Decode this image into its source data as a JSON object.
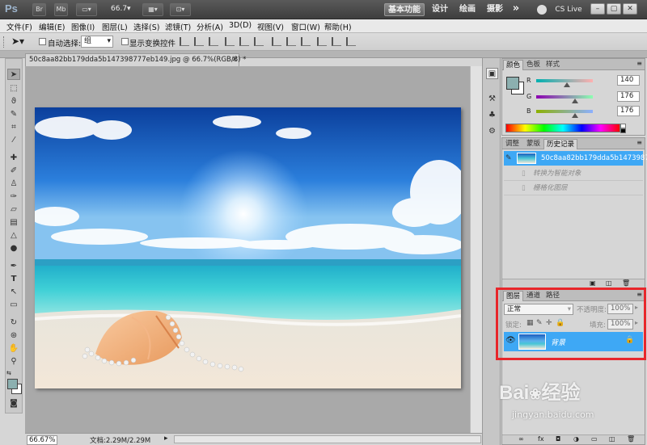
{
  "titlebar": {
    "app_logo": "Ps",
    "bridge_btn": "Br",
    "minibridge_btn": "Mb",
    "zoom_value": "66.7",
    "workspaces": [
      "基本功能",
      "设计",
      "绘画",
      "摄影"
    ],
    "more_symbol": "»",
    "cslive": "CS Live"
  },
  "menu": [
    "文件(F)",
    "编辑(E)",
    "图像(I)",
    "图层(L)",
    "选择(S)",
    "滤镜(T)",
    "分析(A)",
    "3D(D)",
    "视图(V)",
    "窗口(W)",
    "帮助(H)"
  ],
  "options": {
    "auto_select_label": "自动选择:",
    "auto_select_value": "组",
    "show_transform_label": "显示变换控件"
  },
  "document": {
    "tab_title": "50c8aa82bb179dda5b147398777eb149.jpg @ 66.7%(RGB/8) *",
    "close_symbol": "×"
  },
  "status": {
    "zoom": "66.67%",
    "doc_info": "文档:2.29M/2.29M"
  },
  "color_panel": {
    "tabs": [
      "颜色",
      "色板",
      "样式"
    ],
    "channels": [
      {
        "label": "R",
        "value": "140"
      },
      {
        "label": "G",
        "value": "176"
      },
      {
        "label": "B",
        "value": "176"
      }
    ],
    "r_fraction": 0.549,
    "g_fraction": 0.69,
    "b_fraction": 0.69,
    "swatch_color": "#8cb0b0"
  },
  "history_panel": {
    "tabs": [
      "调整",
      "蒙版",
      "历史记录"
    ],
    "snapshot_name": "50c8aa82bb179dda5b1473987...",
    "steps": [
      "转换为智能对象",
      "栅格化图层"
    ]
  },
  "layers_panel": {
    "tabs": [
      "图层",
      "通道",
      "路径"
    ],
    "blend_mode": "正常",
    "opacity_label": "不透明度:",
    "opacity_value": "100%",
    "lock_label": "锁定:",
    "fill_label": "填充:",
    "fill_value": "100%",
    "layer_name": "背景"
  },
  "watermark": {
    "brand": "Bai",
    "brand_cn": "经验",
    "url": "jingyan.baidu.com"
  },
  "colors": {
    "highlight_box": "#e8262b",
    "layer_selected": "#3ea8f5",
    "history_selected": "#3ea8f5"
  }
}
